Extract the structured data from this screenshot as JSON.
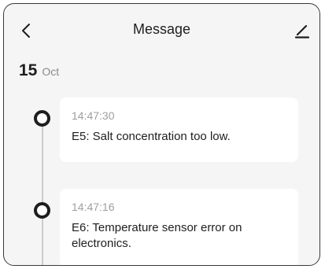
{
  "header": {
    "title": "Message",
    "back_icon": "chevron-left-icon",
    "edit_icon": "edit-pencil-icon"
  },
  "date": {
    "day": "15",
    "month": "Oct"
  },
  "messages": [
    {
      "time": "14:47:30",
      "text": "E5: Salt concentration too low."
    },
    {
      "time": "14:47:16",
      "text": "E6: Temperature sensor error on electronics."
    }
  ]
}
